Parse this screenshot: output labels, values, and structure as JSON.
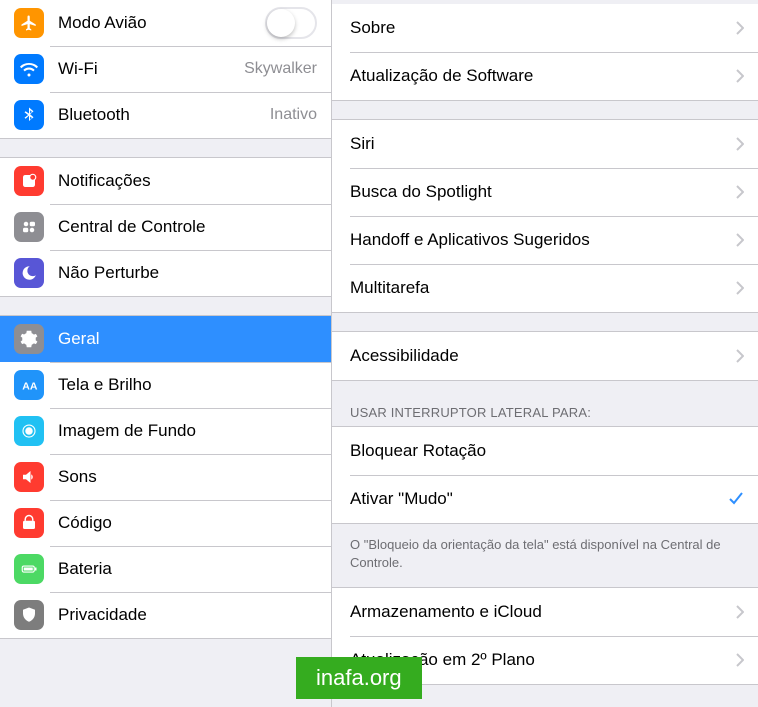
{
  "sidebar": {
    "g1": [
      {
        "label": "Modo Avião",
        "icon": "airplane-icon",
        "bg": "bg-orange",
        "type": "toggle",
        "value": ""
      },
      {
        "label": "Wi-Fi",
        "icon": "wifi-icon",
        "bg": "bg-blue",
        "type": "link",
        "value": "Skywalker"
      },
      {
        "label": "Bluetooth",
        "icon": "bluetooth-icon",
        "bg": "bg-blue",
        "type": "link",
        "value": "Inativo"
      }
    ],
    "g2": [
      {
        "label": "Notificações",
        "icon": "notifications-icon",
        "bg": "bg-red"
      },
      {
        "label": "Central de Controle",
        "icon": "control-center-icon",
        "bg": "bg-gray"
      },
      {
        "label": "Não Perturbe",
        "icon": "dnd-icon",
        "bg": "bg-indigo"
      }
    ],
    "g3": [
      {
        "label": "Geral",
        "icon": "gear-icon",
        "bg": "bg-settings",
        "selected": true
      },
      {
        "label": "Tela e Brilho",
        "icon": "display-icon",
        "bg": "bg-bluea"
      },
      {
        "label": "Imagem de Fundo",
        "icon": "wallpaper-icon",
        "bg": "bg-cyan"
      },
      {
        "label": "Sons",
        "icon": "sounds-icon",
        "bg": "bg-red"
      },
      {
        "label": "Código",
        "icon": "passcode-icon",
        "bg": "bg-red"
      },
      {
        "label": "Bateria",
        "icon": "battery-icon",
        "bg": "bg-green"
      },
      {
        "label": "Privacidade",
        "icon": "privacy-icon",
        "bg": "bg-grayd"
      }
    ]
  },
  "detail": {
    "g1": [
      {
        "label": "Sobre"
      },
      {
        "label": "Atualização de Software"
      }
    ],
    "g2": [
      {
        "label": "Siri"
      },
      {
        "label": "Busca do Spotlight"
      },
      {
        "label": "Handoff e Aplicativos Sugeridos"
      },
      {
        "label": "Multitarefa"
      }
    ],
    "g3": [
      {
        "label": "Acessibilidade"
      }
    ],
    "switch_header": "Usar interruptor lateral para:",
    "g4": [
      {
        "label": "Bloquear Rotação",
        "checked": false
      },
      {
        "label": "Ativar \"Mudo\"",
        "checked": true
      }
    ],
    "switch_footer": "O \"Bloqueio da orientação da tela\" está disponível na Central de Controle.",
    "g5": [
      {
        "label": "Armazenamento e iCloud"
      },
      {
        "label": "Atualização em 2º Plano"
      }
    ]
  },
  "watermark": "inafa.org"
}
